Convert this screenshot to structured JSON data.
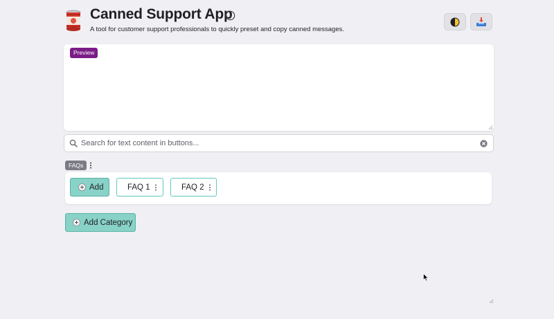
{
  "header": {
    "app_icon": "tin-can-icon",
    "title": "Canned Support App",
    "subtitle": "A tool for customer support professionals to quickly preset and copy canned messages.",
    "info_icon": "info-icon",
    "theme_toggle_icon": "contrast-icon",
    "share_icon": "inbox-tray-icon"
  },
  "preview": {
    "badge": "Preview",
    "text": ""
  },
  "search": {
    "placeholder": "Search for text content in buttons...",
    "value": ""
  },
  "categories": [
    {
      "name": "FAQs",
      "add_label": "Add",
      "buttons": [
        {
          "label": "FAQ 1"
        },
        {
          "label": "FAQ 2"
        }
      ]
    }
  ],
  "add_category_label": "Add Category",
  "colors": {
    "accent": "#88d2c8",
    "accent_border": "#58b2a6",
    "preview_badge": "#7a1c87",
    "category_badge": "#7b7b86",
    "background": "#f0f0f4"
  }
}
